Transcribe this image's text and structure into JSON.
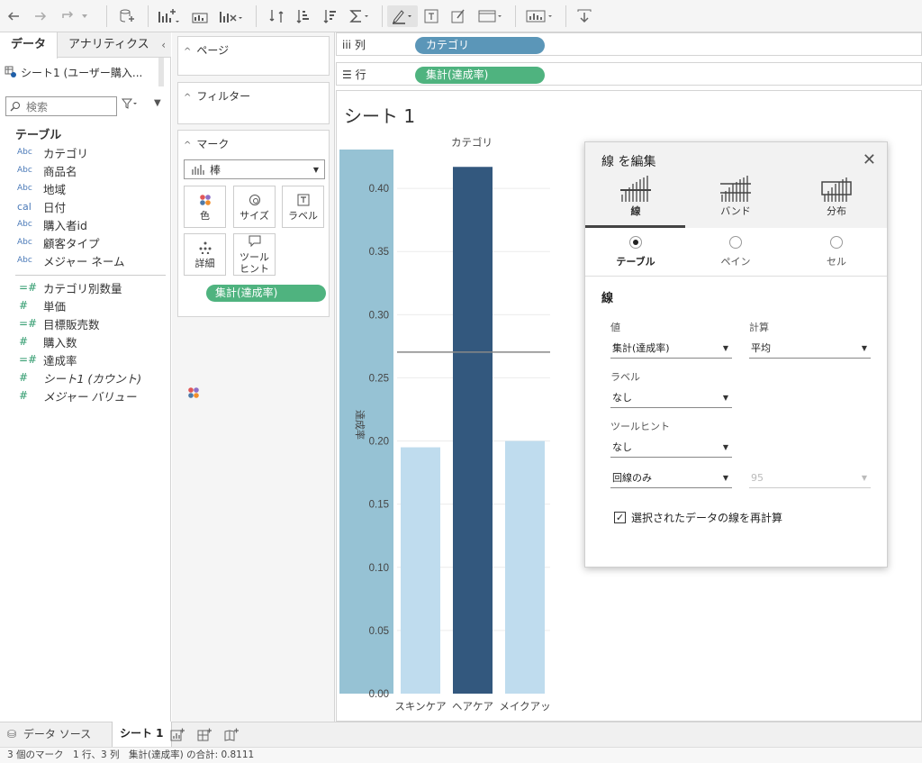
{
  "data_pane": {
    "tab_data": "データ",
    "tab_analytics": "アナリティクス",
    "collapse_glyph": "‹",
    "data_source": "シート1 (ユーザー購入...",
    "search_placeholder": "検索",
    "section_title": "テーブル",
    "dimensions": [
      {
        "type": "Abc",
        "name": "カテゴリ"
      },
      {
        "type": "Abc",
        "name": "商品名"
      },
      {
        "type": "Abc",
        "name": "地域"
      },
      {
        "type": "cal",
        "name": "日付"
      },
      {
        "type": "Abc",
        "name": "購入者id"
      },
      {
        "type": "Abc",
        "name": "顧客タイプ"
      },
      {
        "type": "Abc",
        "name": "メジャー ネーム"
      }
    ],
    "measures": [
      {
        "type": "=#",
        "name": "カテゴリ別数量"
      },
      {
        "type": "#",
        "name": "単価"
      },
      {
        "type": "=#",
        "name": "目標販売数"
      },
      {
        "type": "#",
        "name": "購入数"
      },
      {
        "type": "=#",
        "name": "達成率"
      },
      {
        "type": "#",
        "name": "シート1 (カウント)"
      },
      {
        "type": "#",
        "name": "メジャー バリュー"
      }
    ]
  },
  "shelves": {
    "pages_title": "ページ",
    "filters_title": "フィルター",
    "marks_title": "マーク",
    "mark_type": "棒",
    "mark_buttons": [
      "色",
      "サイズ",
      "ラベル",
      "詳細",
      "ツールヒント"
    ],
    "mark_pill": "集計(達成率)",
    "columns_label": "列",
    "columns_pill": "カテゴリ",
    "rows_label": "行",
    "rows_pill": "集計(達成率)"
  },
  "colors": {
    "dimension_pill": "#5b96b8",
    "measure_pill": "#4fb37f",
    "bar_light": "#bfdcee",
    "bar_dark": "#33587e",
    "highlight_band": "#96c2d4",
    "ref_line": "#888888"
  },
  "view": {
    "sheet_title": "シート 1"
  },
  "chart_data": {
    "type": "bar",
    "title": "",
    "column_header": "カテゴリ",
    "ylabel": "達成率",
    "categories": [
      "スキンケア",
      "ヘアケア",
      "メイクアップ"
    ],
    "category_labels": [
      "スキンケア",
      "ヘアケア",
      "メイクアッ"
    ],
    "values": [
      0.195,
      0.417,
      0.2
    ],
    "yticks": [
      "0.00",
      "0.05",
      "0.10",
      "0.15",
      "0.20",
      "0.25",
      "0.30",
      "0.35",
      "0.40"
    ],
    "ylim": [
      0,
      0.44
    ],
    "reference_line": 0.2704,
    "highlighted_category": "ヘアケア",
    "axis_highlighted": true,
    "grid": true
  },
  "dialog": {
    "title": "線 を編集",
    "close_glyph": "✕",
    "tabs": [
      "線",
      "バンド",
      "分布"
    ],
    "scopes": [
      "テーブル",
      "ペイン",
      "セル"
    ],
    "selected_scope": "テーブル",
    "section": "線",
    "value_label": "値",
    "value": "集計(達成率)",
    "calc_label": "計算",
    "calc": "平均",
    "label_label": "ラベル",
    "label_value": "なし",
    "tooltip_label": "ツールヒント",
    "tooltip_value": "なし",
    "line_only": "回線のみ",
    "confidence": "95",
    "recalc_checkbox": "選択されたデータの線を再計算",
    "recalc_checked": true
  },
  "bottom_tabs": {
    "data_source": "データ ソース",
    "sheet": "シート 1"
  },
  "status_bar": "3 個のマーク　1 行、3 列　集計(達成率) の合計: 0.8111"
}
